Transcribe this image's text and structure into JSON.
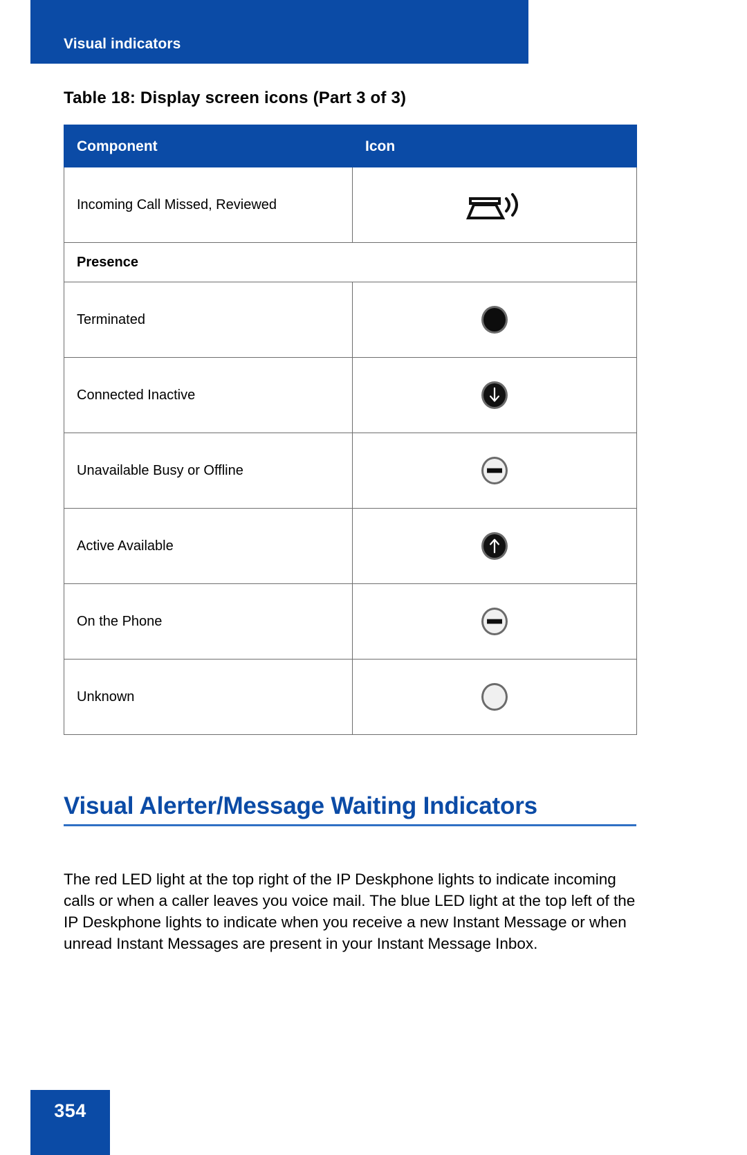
{
  "header": {
    "running_head": "Visual indicators",
    "banner_color": "#0B4BA6"
  },
  "table": {
    "caption": "Table 18: Display screen icons (Part 3 of 3)",
    "columns": [
      "Component",
      "Icon"
    ],
    "rows": [
      {
        "type": "data",
        "component": "Incoming Call Missed, Reviewed",
        "icon": "phone-ringing-icon"
      },
      {
        "type": "section",
        "component": "Presence",
        "icon": ""
      },
      {
        "type": "data",
        "component": "Terminated",
        "icon": "presence-filled-dot-icon"
      },
      {
        "type": "data",
        "component": "Connected Inactive",
        "icon": "presence-down-arrow-icon"
      },
      {
        "type": "data",
        "component": "Unavailable Busy or Offline",
        "icon": "presence-busy-bar-icon"
      },
      {
        "type": "data",
        "component": "Active Available",
        "icon": "presence-up-arrow-icon"
      },
      {
        "type": "data",
        "component": "On the Phone",
        "icon": "presence-busy-bar-icon"
      },
      {
        "type": "data",
        "component": "Unknown",
        "icon": "presence-empty-dot-icon"
      }
    ]
  },
  "section": {
    "heading": "Visual Alerter/Message Waiting Indicators",
    "heading_color": "#0B4BA6",
    "paragraph": "The red LED light at the top right of the IP Deskphone lights to indicate incoming calls or when a caller leaves you voice mail. The blue LED light at the top left of the IP Deskphone lights to indicate when you receive a new Instant Message or when unread Instant Messages are present in your Instant Message Inbox."
  },
  "footer": {
    "page_number": "354"
  }
}
